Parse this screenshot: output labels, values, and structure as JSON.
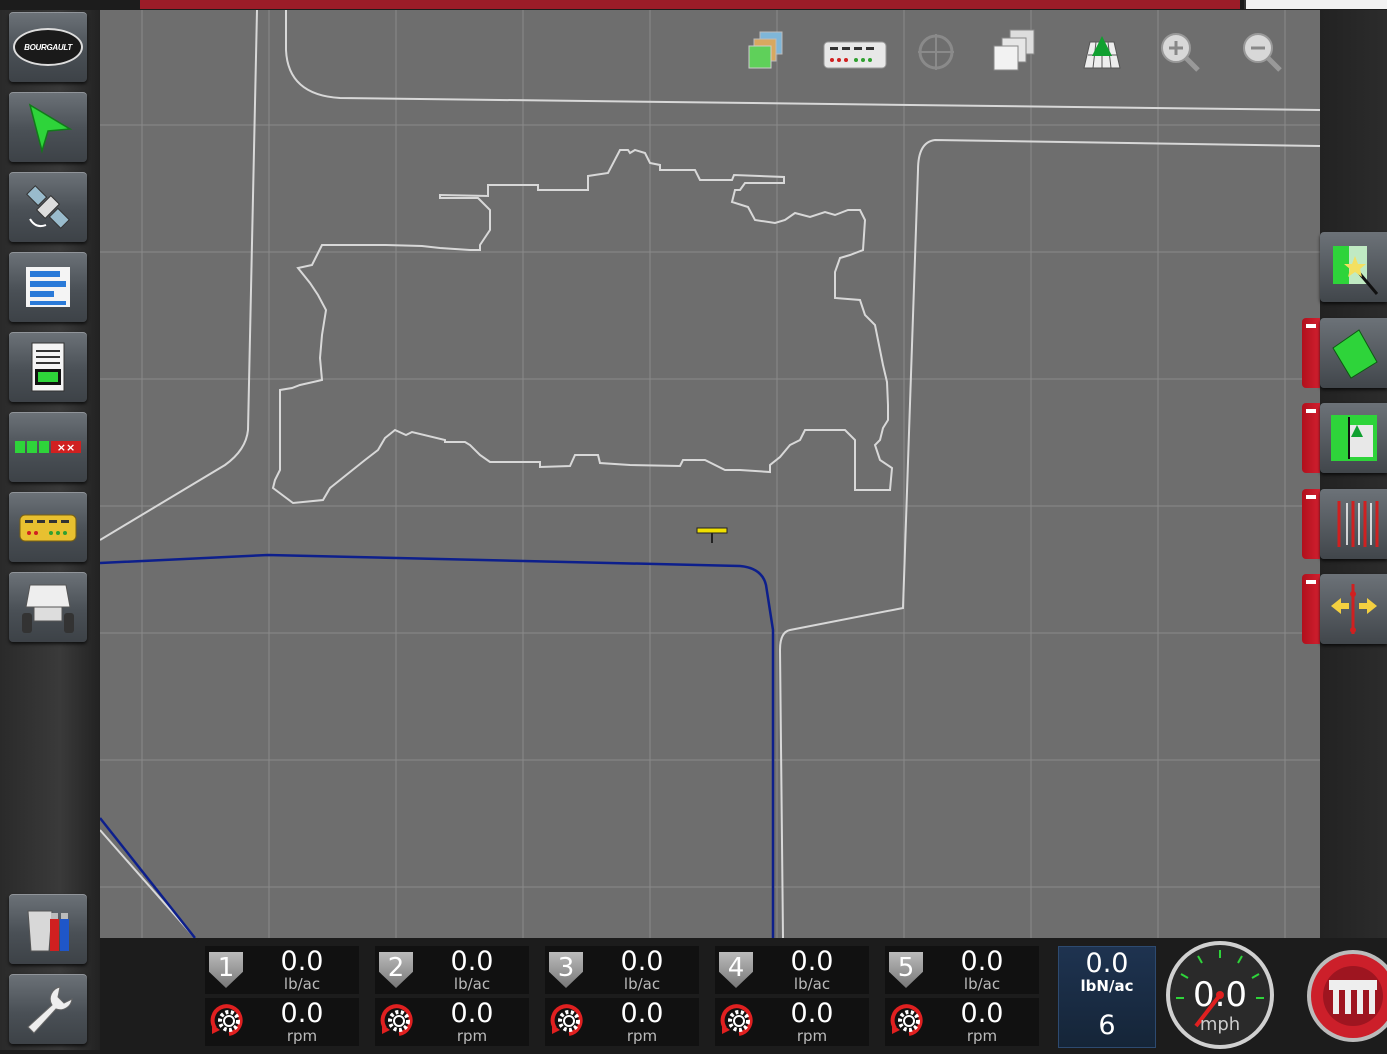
{
  "app": {
    "logo_text": "BOURGAULT",
    "accent": "#9b1c28"
  },
  "left_sidebar": {
    "items": [
      {
        "name": "bourgault-logo-button",
        "icon": "bourgault-logo"
      },
      {
        "name": "guidance-button",
        "icon": "green-arrow-icon"
      },
      {
        "name": "gps-satellite-button",
        "icon": "satellite-icon"
      },
      {
        "name": "mini-views-button",
        "icon": "bars-icon"
      },
      {
        "name": "job-report-button",
        "icon": "report-icon"
      },
      {
        "name": "section-status-button",
        "icon": "sections-icon",
        "section_mark": "××"
      },
      {
        "name": "implement-button",
        "icon": "implement-icon"
      },
      {
        "name": "air-cart-button",
        "icon": "cart-icon"
      },
      {
        "name": "data-transfer-button",
        "icon": "usb-trash-icon"
      },
      {
        "name": "setup-button",
        "icon": "wrench-icon"
      }
    ]
  },
  "map_toolbar": {
    "items": [
      "layers-icon",
      "implement-view-icon",
      "center-icon",
      "views-icon",
      "perspective-icon",
      "zoom-in-icon",
      "zoom-out-icon"
    ]
  },
  "right_sidebar": {
    "items": [
      "boundary-wizard-icon",
      "field-boundary-icon",
      "headland-icon",
      "guidance-lines-icon",
      "nudge-icon"
    ]
  },
  "sections": [
    {
      "num": "1",
      "rate": "0.0",
      "rate_unit": "lb/ac",
      "speed": "0.0",
      "speed_unit": "rpm"
    },
    {
      "num": "2",
      "rate": "0.0",
      "rate_unit": "lb/ac",
      "speed": "0.0",
      "speed_unit": "rpm"
    },
    {
      "num": "3",
      "rate": "0.0",
      "rate_unit": "lb/ac",
      "speed": "0.0",
      "speed_unit": "rpm"
    },
    {
      "num": "4",
      "rate": "0.0",
      "rate_unit": "lb/ac",
      "speed": "0.0",
      "speed_unit": "rpm"
    },
    {
      "num": "5",
      "rate": "0.0",
      "rate_unit": "lb/ac",
      "speed": "0.0",
      "speed_unit": "rpm"
    }
  ],
  "target_rate": {
    "value": "0.0",
    "unit": "lbN/ac",
    "product": "6"
  },
  "speedometer": {
    "value": "0.0",
    "unit": "mph"
  },
  "master_switch": {
    "icon": "master-switch-icon",
    "color": "#cc1f2a"
  }
}
